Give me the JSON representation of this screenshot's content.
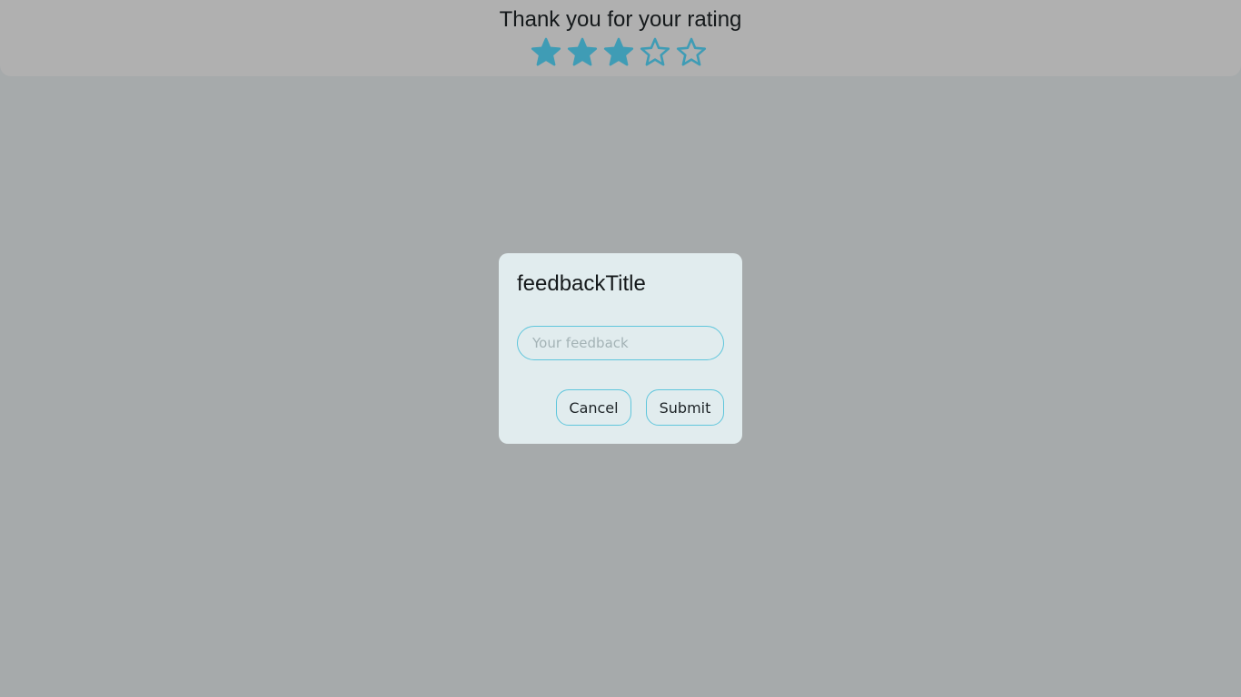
{
  "rating": {
    "title": "Thank you for your rating",
    "value": 3,
    "max": 5,
    "star_color": "#3f9cb5"
  },
  "dialog": {
    "title": "feedbackTitle",
    "input": {
      "placeholder": "Your feedback",
      "value": ""
    },
    "cancel_label": "Cancel",
    "submit_label": "Submit",
    "accent_color": "#5fc6dc"
  }
}
